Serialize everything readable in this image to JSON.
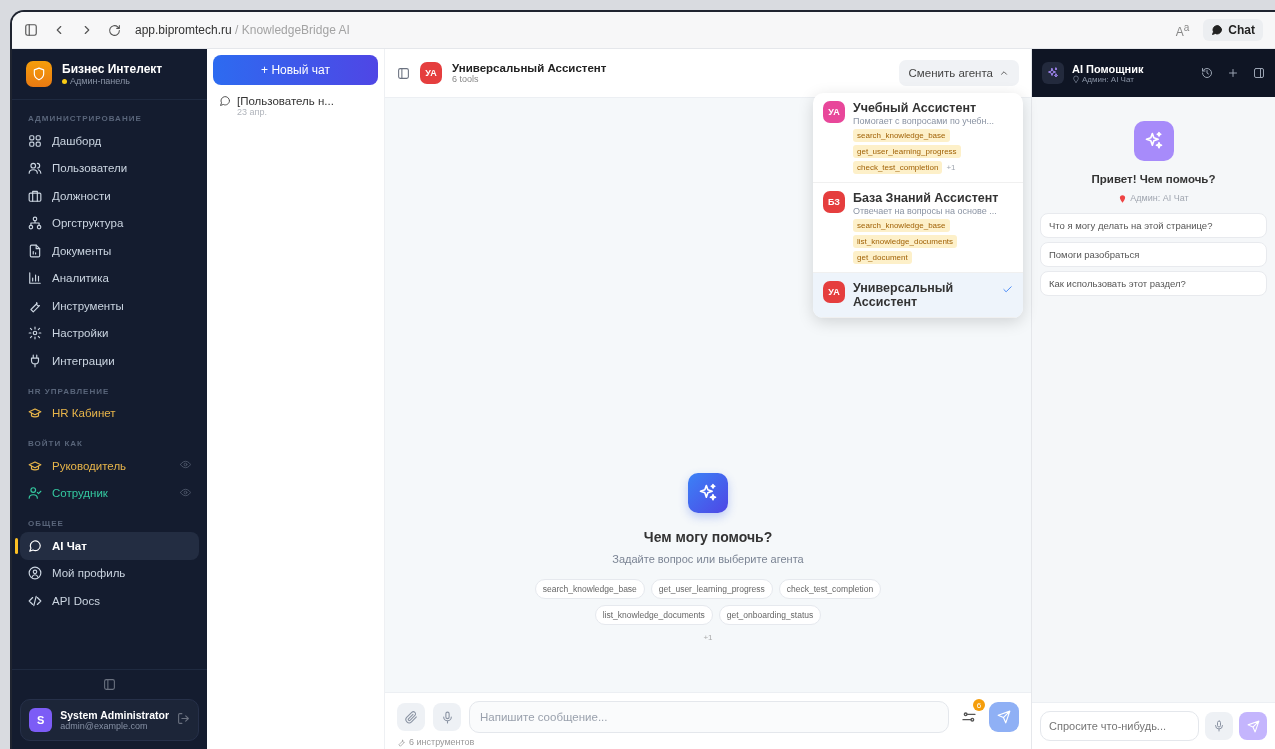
{
  "browser": {
    "host": "app.bipromtech.ru",
    "path": " / KnowledgeBridge AI",
    "chat_button": "Chat",
    "text_size": "A$^{a}$"
  },
  "sidebar": {
    "brand": {
      "title": "Бизнес Интелект",
      "subtitle": "Админ-панель"
    },
    "sections": [
      {
        "heading": "АДМИНИСТРИРОВАНИЕ",
        "items": [
          {
            "label": "Дашборд",
            "kind": "link",
            "color": "#cbd5e1",
            "selected": false
          },
          {
            "label": "Пользователи",
            "kind": "link",
            "color": "#cbd5e1",
            "selected": false
          },
          {
            "label": "Должности",
            "kind": "link",
            "color": "#cbd5e1",
            "selected": false
          },
          {
            "label": "Оргструктура",
            "kind": "link",
            "color": "#cbd5e1",
            "selected": false
          },
          {
            "label": "Документы",
            "kind": "link",
            "color": "#cbd5e1",
            "selected": false
          },
          {
            "label": "Аналитика",
            "kind": "link",
            "color": "#cbd5e1",
            "selected": false
          },
          {
            "label": "Инструменты",
            "kind": "link",
            "color": "#cbd5e1",
            "selected": false
          },
          {
            "label": "Настройки",
            "kind": "link",
            "color": "#cbd5e1",
            "selected": false
          },
          {
            "label": "Интеграции",
            "kind": "link",
            "color": "#cbd5e1",
            "selected": false
          }
        ]
      },
      {
        "heading": "HR УПРАВЛЕНИЕ",
        "items": [
          {
            "label": "HR Кабинет",
            "kind": "link",
            "color": "#e8b54a",
            "selected": false
          }
        ]
      },
      {
        "heading": "ВОЙТИ КАК",
        "items": [
          {
            "label": "Руководитель",
            "kind": "impersonate",
            "color": "#e8b54a",
            "selected": false
          },
          {
            "label": "Сотрудник",
            "kind": "impersonate",
            "color": "#34c9a0",
            "selected": false
          }
        ]
      },
      {
        "heading": "ОБЩЕЕ",
        "items": [
          {
            "label": "AI Чат",
            "kind": "link",
            "color": "#ffffff",
            "selected": true
          },
          {
            "label": "Мой профиль",
            "kind": "link",
            "color": "#cbd5e1",
            "selected": false
          },
          {
            "label": "API Docs",
            "kind": "link",
            "color": "#cbd5e1",
            "selected": false
          }
        ]
      }
    ],
    "user": {
      "initial": "S",
      "name": "System Administrator",
      "email": "admin@example.com"
    }
  },
  "chat_list": {
    "new_chat": "+ Новый чат",
    "chats": [
      {
        "title": "[Пользователь н...",
        "date": "23 апр.",
        "selected": false
      }
    ]
  },
  "main": {
    "header": {
      "avatar": "УА",
      "title": "Универсальный Ассистент",
      "subtitle": "6 tools",
      "switch_button": "Сменить агента"
    },
    "agents": [
      {
        "avatar": "УА",
        "color": "#e8479a",
        "name": "Учебный Ассистент",
        "description": "Помогает с вопросами по учебн...",
        "tools": [
          "search_knowledge_base",
          "get_user_learning_progress",
          "check_test_completion"
        ],
        "more": "+1",
        "selected": false
      },
      {
        "avatar": "БЗ",
        "color": "#e53e3e",
        "name": "База Знаний Ассистент",
        "description": "Отвечает на вопросы на основе ...",
        "tools": [
          "search_knowledge_base",
          "list_knowledge_documents",
          "get_document"
        ],
        "selected": false
      },
      {
        "avatar": "УА",
        "color": "#e53e3e",
        "name": "Универсальный Ассистент",
        "selected": true
      }
    ],
    "empty": {
      "title": "Чем могу помочь?",
      "subtitle": "Задайте вопрос или выберите агента",
      "tools": [
        "search_knowledge_base",
        "get_user_learning_progress",
        "check_test_completion",
        "list_knowledge_documents",
        "get_onboarding_status"
      ],
      "more": "+1"
    },
    "composer": {
      "placeholder": "Напишите сообщение...",
      "badge": "6",
      "tools_note": "6 инструментов"
    }
  },
  "assistant": {
    "title": "AI Помощник",
    "subtitle": "Админ: AI Чат",
    "greeting": "Привет! Чем помочь?",
    "location": "Админ: AI Чат",
    "suggestions": [
      "Что я могу делать на этой странице?",
      "Помоги разобраться",
      "Как использовать этот раздел?"
    ],
    "placeholder": "Спросите что-нибудь..."
  }
}
